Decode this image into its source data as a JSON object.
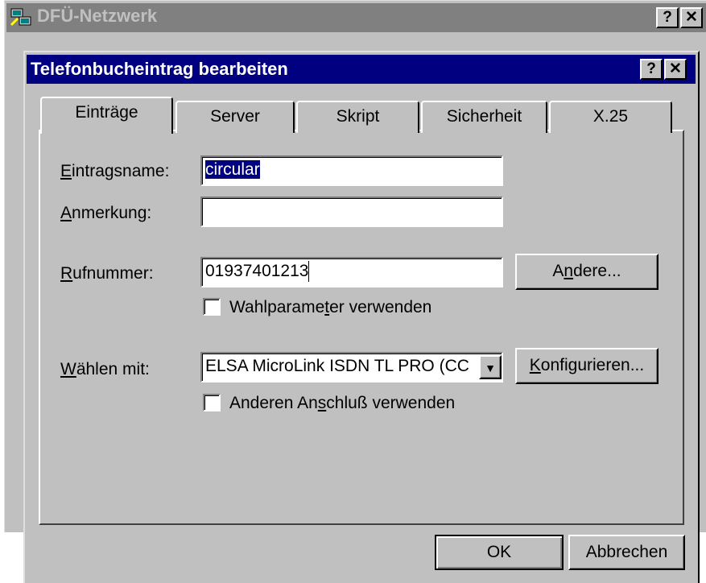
{
  "bg_window": {
    "title": "DFÜ-Netzwerk",
    "help_label": "?",
    "close_label": "✕"
  },
  "dialog": {
    "title": "Telefonbucheintrag bearbeiten",
    "help_label": "?",
    "close_label": "✕"
  },
  "tabs": [
    {
      "label": "Einträge",
      "active": true
    },
    {
      "label": "Server",
      "active": false
    },
    {
      "label": "Skript",
      "active": false
    },
    {
      "label": "Sicherheit",
      "active": false
    },
    {
      "label": "X.25",
      "active": false
    }
  ],
  "form": {
    "entry_name": {
      "label_key": "E",
      "label_rest": "intragsname:",
      "value": "circular"
    },
    "note": {
      "label_key": "A",
      "label_rest": "nmerkung:",
      "value": ""
    },
    "phone": {
      "label_key": "R",
      "label_rest": "ufnummer:",
      "value": "01937401213"
    },
    "other_button": {
      "pre": "A",
      "key": "n",
      "post": "dere..."
    },
    "dial_params": {
      "pre": "Wahlparame",
      "key": "t",
      "post": "er verwenden",
      "checked": false
    },
    "dial_with": {
      "label_key": "W",
      "label_rest": "ählen mit:",
      "value": "ELSA MicroLink ISDN TL PRO (CC"
    },
    "configure_button": {
      "key": "K",
      "post": "onfigurieren..."
    },
    "other_port": {
      "pre": "Anderen An",
      "key": "s",
      "post": "chluß verwenden",
      "checked": false
    }
  },
  "footer": {
    "ok_label": "OK",
    "cancel_label": "Abbrechen"
  }
}
